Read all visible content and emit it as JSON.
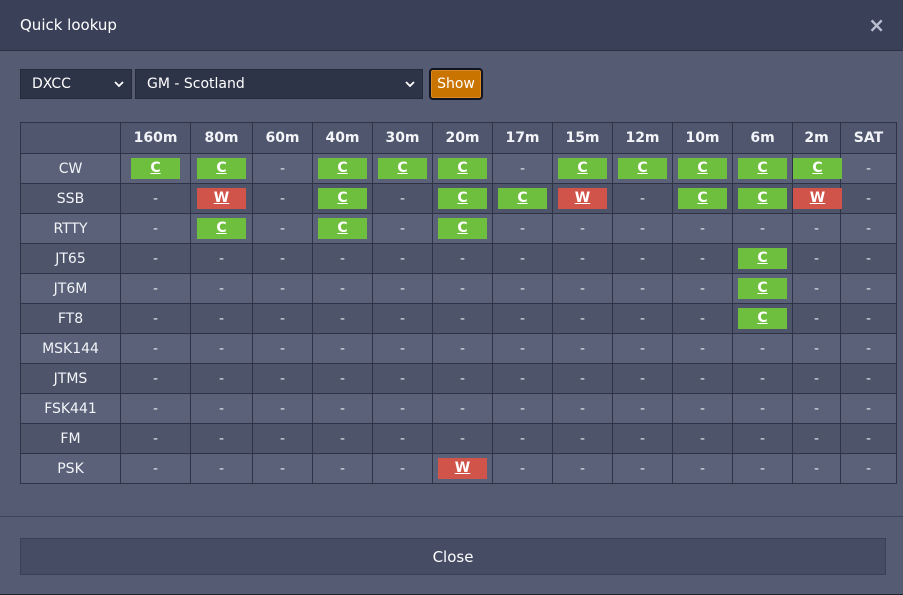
{
  "modal": {
    "title": "Quick lookup",
    "close_symbol": "×"
  },
  "controls": {
    "type_select": "DXCC",
    "value_select": "GM - Scotland",
    "show_label": "Show"
  },
  "grid": {
    "bands": [
      "160m",
      "80m",
      "60m",
      "40m",
      "30m",
      "20m",
      "17m",
      "15m",
      "12m",
      "10m",
      "6m",
      "2m",
      "SAT"
    ],
    "rows": [
      {
        "mode": "CW",
        "cells": [
          "C",
          "C",
          "-",
          "C",
          "C",
          "C",
          "-",
          "C",
          "C",
          "C",
          "C",
          "C",
          "-"
        ]
      },
      {
        "mode": "SSB",
        "cells": [
          "-",
          "W",
          "-",
          "C",
          "-",
          "C",
          "C",
          "W",
          "-",
          "C",
          "C",
          "W",
          "-"
        ]
      },
      {
        "mode": "RTTY",
        "cells": [
          "-",
          "C",
          "-",
          "C",
          "-",
          "C",
          "-",
          "-",
          "-",
          "-",
          "-",
          "-",
          "-"
        ]
      },
      {
        "mode": "JT65",
        "cells": [
          "-",
          "-",
          "-",
          "-",
          "-",
          "-",
          "-",
          "-",
          "-",
          "-",
          "C",
          "-",
          "-"
        ]
      },
      {
        "mode": "JT6M",
        "cells": [
          "-",
          "-",
          "-",
          "-",
          "-",
          "-",
          "-",
          "-",
          "-",
          "-",
          "C",
          "-",
          "-"
        ]
      },
      {
        "mode": "FT8",
        "cells": [
          "-",
          "-",
          "-",
          "-",
          "-",
          "-",
          "-",
          "-",
          "-",
          "-",
          "C",
          "-",
          "-"
        ]
      },
      {
        "mode": "MSK144",
        "cells": [
          "-",
          "-",
          "-",
          "-",
          "-",
          "-",
          "-",
          "-",
          "-",
          "-",
          "-",
          "-",
          "-"
        ]
      },
      {
        "mode": "JTMS",
        "cells": [
          "-",
          "-",
          "-",
          "-",
          "-",
          "-",
          "-",
          "-",
          "-",
          "-",
          "-",
          "-",
          "-"
        ]
      },
      {
        "mode": "FSK441",
        "cells": [
          "-",
          "-",
          "-",
          "-",
          "-",
          "-",
          "-",
          "-",
          "-",
          "-",
          "-",
          "-",
          "-"
        ]
      },
      {
        "mode": "FM",
        "cells": [
          "-",
          "-",
          "-",
          "-",
          "-",
          "-",
          "-",
          "-",
          "-",
          "-",
          "-",
          "-",
          "-"
        ]
      },
      {
        "mode": "PSK",
        "cells": [
          "-",
          "-",
          "-",
          "-",
          "-",
          "W",
          "-",
          "-",
          "-",
          "-",
          "-",
          "-",
          "-"
        ]
      }
    ]
  },
  "colors": {
    "confirmed": "#6fbf3e",
    "worked": "#d0544a",
    "show_button": "#c97400"
  },
  "footer": {
    "close_label": "Close"
  }
}
